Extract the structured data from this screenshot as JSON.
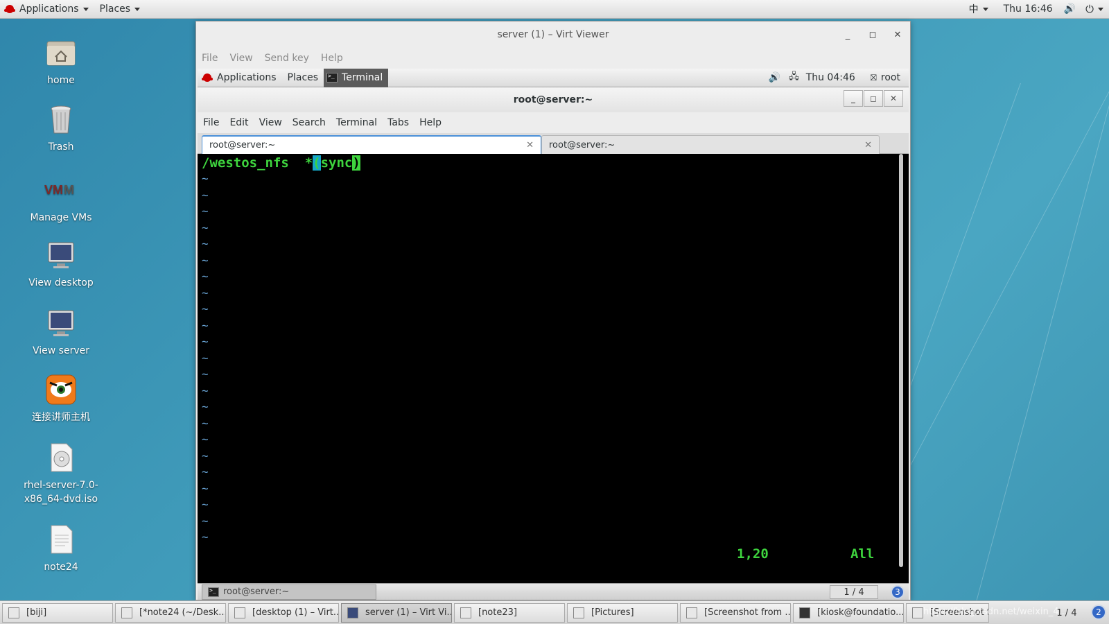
{
  "host": {
    "top_bar": {
      "applications": "Applications",
      "places": "Places",
      "input_method": "中",
      "clock": "Thu 16:46"
    },
    "desktop_icons": [
      {
        "label": "home",
        "icon": "home-folder-icon"
      },
      {
        "label": "Trash",
        "icon": "trash-icon"
      },
      {
        "label": "Manage VMs",
        "icon": "vmm-icon"
      },
      {
        "label": "View desktop",
        "icon": "monitor-icon"
      },
      {
        "label": "View server",
        "icon": "monitor-icon"
      },
      {
        "label": "连接讲师主机",
        "icon": "tiger-icon"
      },
      {
        "label": "rhel-server-7.0-x86_64-dvd.iso",
        "icon": "disc-icon"
      },
      {
        "label": "note24",
        "icon": "text-file-icon"
      }
    ],
    "taskbar": [
      {
        "label": "[biji]"
      },
      {
        "label": "[*note24 (~/Desk..."
      },
      {
        "label": "[desktop (1) – Virt..."
      },
      {
        "label": "server (1) – Virt Vi..."
      },
      {
        "label": "[note23]"
      },
      {
        "label": "[Pictures]"
      },
      {
        "label": "[Screenshot from ..."
      },
      {
        "label": "[kiosk@foundatio..."
      },
      {
        "label": "[Screenshot from ..."
      }
    ],
    "pager": "1 / 4",
    "notify_count": "2",
    "watermark": "https://blog.csdn.net/weixin_4..."
  },
  "virt_viewer": {
    "title": "server (1) – Virt Viewer",
    "menu": [
      "File",
      "View",
      "Send key",
      "Help"
    ]
  },
  "guest": {
    "top_bar": {
      "applications": "Applications",
      "places": "Places",
      "terminal_task": "Terminal",
      "clock": "Thu 04:46",
      "user": "root"
    },
    "terminal": {
      "title": "root@server:~",
      "menu": [
        "File",
        "Edit",
        "View",
        "Search",
        "Terminal",
        "Tabs",
        "Help"
      ],
      "tabs": [
        {
          "label": "root@server:~"
        },
        {
          "label": "root@server:~"
        }
      ],
      "line1_pre": "/westos_nfs  *",
      "line1_cursor1": "(",
      "line1_mid": "sync",
      "line1_cursor2": ")",
      "tilde": "~",
      "position": "1,20",
      "scroll": "All"
    },
    "bottom_bar": {
      "task": "root@server:~",
      "pager": "1 / 4",
      "notify_count": "3"
    }
  }
}
